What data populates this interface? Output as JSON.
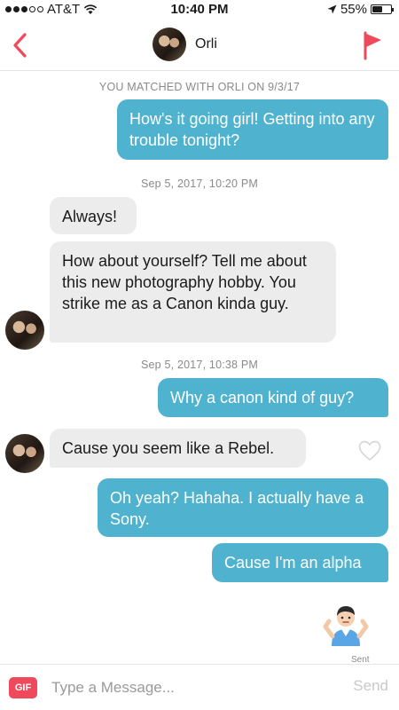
{
  "status": {
    "carrier": "AT&T",
    "time": "10:40 PM",
    "battery": "55%",
    "battery_level": 0.55
  },
  "header": {
    "name": "Orli"
  },
  "conversation": {
    "matched_note": "YOU MATCHED WITH ORLI ON 9/3/17",
    "messages": [
      {
        "text": "How's it going girl! Getting into any trouble tonight?"
      },
      {
        "text": "Always!"
      },
      {
        "text": "How about yourself? Tell me about this new photography hobby. You strike me as a Canon kinda guy."
      },
      {
        "text": "Why a canon kind of guy?"
      },
      {
        "text": "Cause you seem like a Rebel."
      },
      {
        "text": "Oh yeah? Hahaha. I actually have a Sony."
      },
      {
        "text": "Cause I'm an alpha"
      }
    ],
    "timestamps": [
      "Sep 5, 2017, 10:20 PM",
      "Sep 5, 2017, 10:38 PM"
    ],
    "sent_label": "Sent"
  },
  "composer": {
    "gif_label": "GIF",
    "placeholder": "Type a Message...",
    "send_label": "Send"
  },
  "colors": {
    "outgoing_bubble": "#4fb2cf",
    "incoming_bubble": "#ececec",
    "accent": "#ef4a5c"
  }
}
